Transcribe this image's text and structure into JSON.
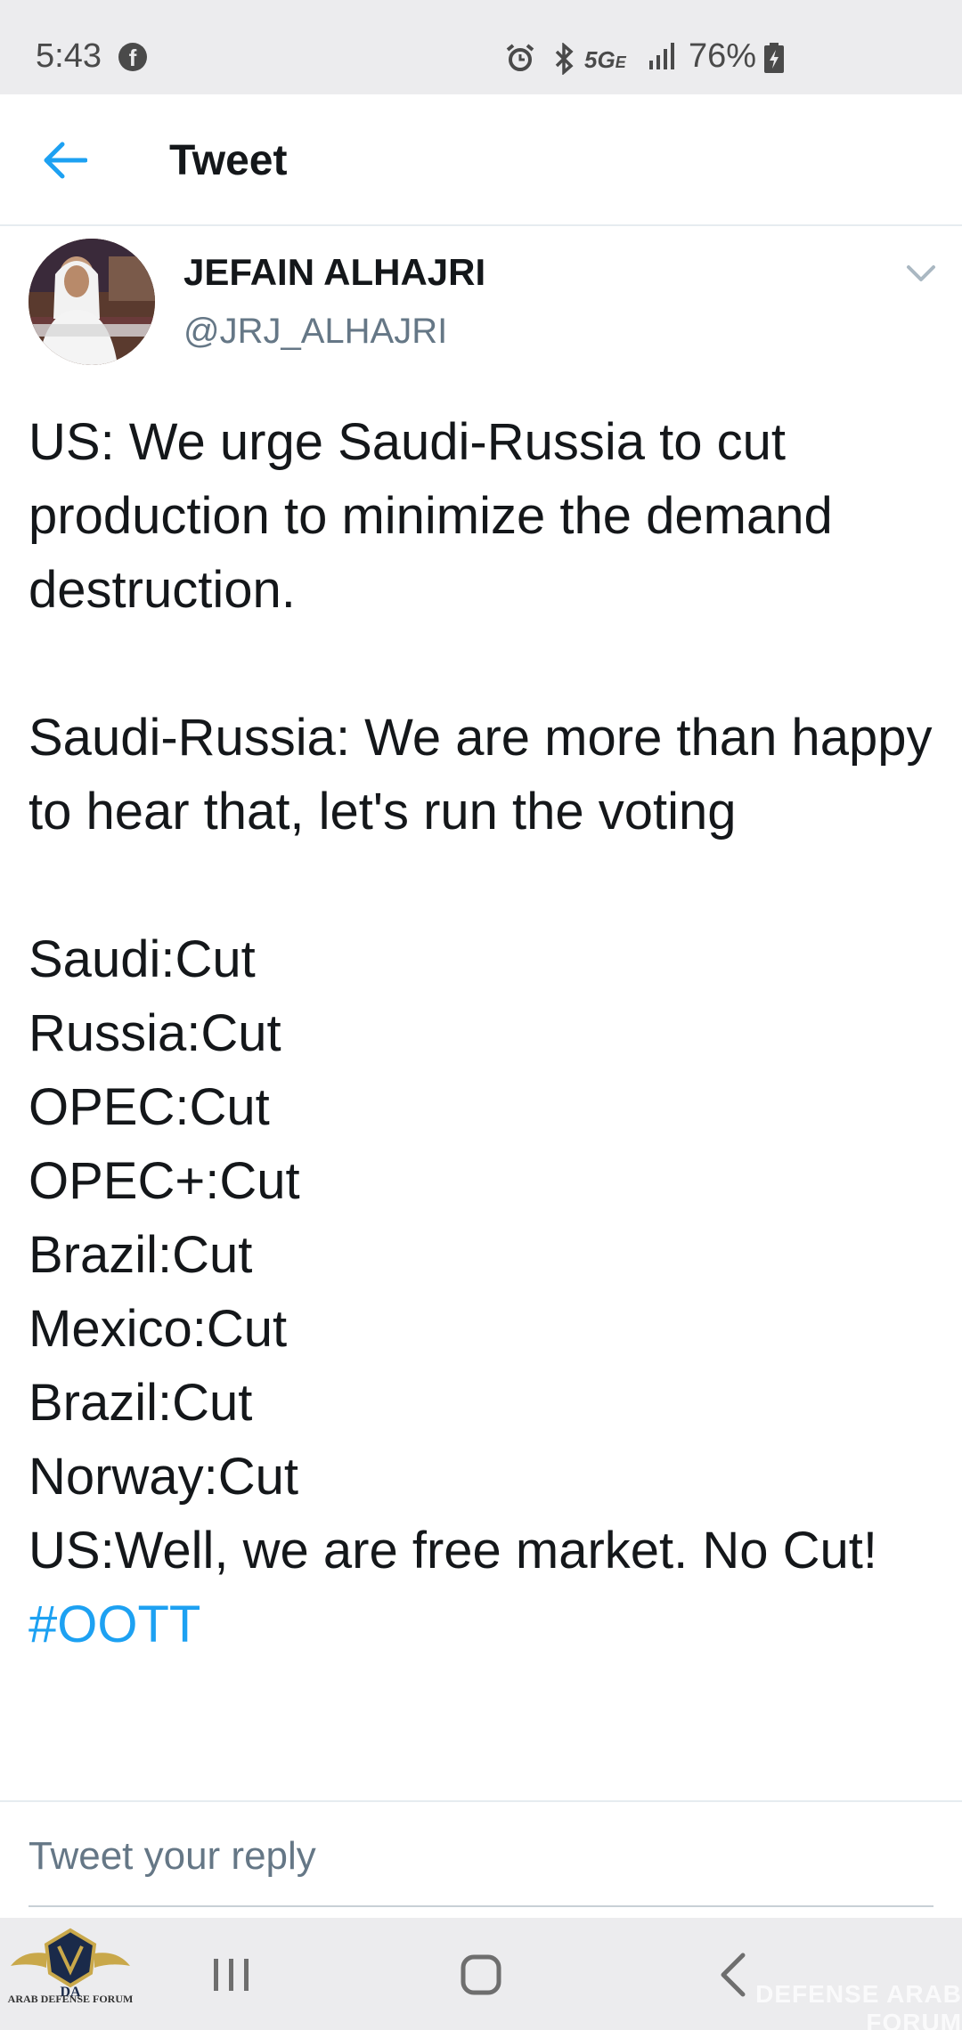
{
  "status_bar": {
    "time": "5:43",
    "network": "5G",
    "network_sub": "E",
    "battery": "76%"
  },
  "header": {
    "title": "Tweet"
  },
  "tweet": {
    "author_name": "JEFAIN ALHAJRI",
    "handle": "@JRJ_ALHAJRI",
    "paragraph1": "US: We urge Saudi-Russia to cut production to minimize the demand destruction.",
    "paragraph2": "Saudi-Russia: We are more than happy to hear that, let's run the voting",
    "vote_lines": [
      "Saudi:Cut",
      "Russia:Cut",
      "OPEC:Cut",
      "OPEC+:Cut",
      "Brazil:Cut",
      "Mexico:Cut",
      "Brazil:Cut",
      "Norway:Cut"
    ],
    "closing_line": "US:Well, we are free market. No Cut!",
    "hashtag": "#OOTT"
  },
  "reply": {
    "placeholder": "Tweet your reply"
  },
  "watermark": {
    "logo_text": "ARAB DEFENSE FORUM",
    "logo_letters": "DA",
    "right_text": "DEFENSE ARAB FORUM"
  },
  "colors": {
    "link_blue": "#1da1f2",
    "text_primary": "#14171a",
    "text_secondary": "#657786",
    "status_bar_bg": "#ececee"
  }
}
